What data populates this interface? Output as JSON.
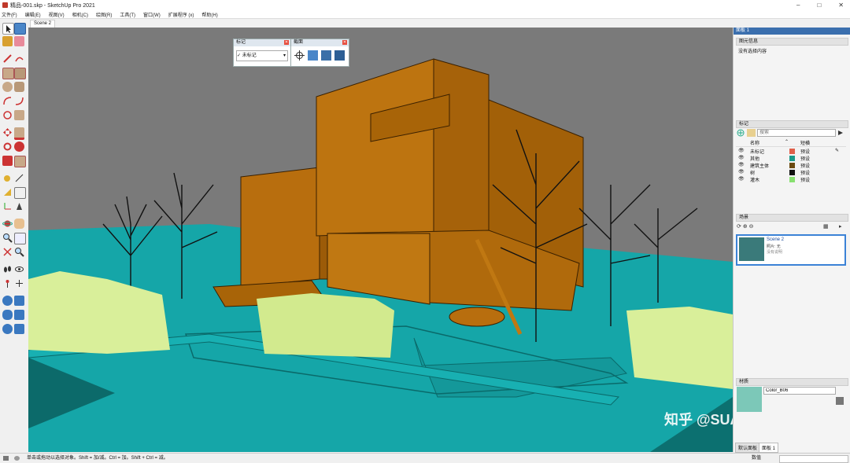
{
  "window": {
    "title": "精品-001.skp - SketchUp Pro 2021",
    "controls": [
      "–",
      "□",
      "✕"
    ]
  },
  "menu": [
    "文件(F)",
    "编辑(E)",
    "视图(V)",
    "相机(C)",
    "绘图(R)",
    "工具(T)",
    "窗口(W)",
    "扩展程序 (x)",
    "帮助(H)"
  ],
  "scene_tab": "Scene 2",
  "tag_float": {
    "title": "标记",
    "value": "未标记",
    "check": "✓"
  },
  "section_float": {
    "title": "截面"
  },
  "panel": {
    "title": "面板 1",
    "entity_info": {
      "header": "图元信息",
      "text": "没有选择内容"
    },
    "tags": {
      "header": "标记",
      "search_placeholder": "搜索",
      "col_name": "名称",
      "col_style": "短横",
      "rows": [
        {
          "name": "未标记",
          "color": "#e0604a",
          "style": "预设"
        },
        {
          "name": "其他",
          "color": "#1a9a8a",
          "style": "预设"
        },
        {
          "name": "建筑主体",
          "color": "#6a4a10",
          "style": "预设"
        },
        {
          "name": "树",
          "color": "#111111",
          "style": "预设"
        },
        {
          "name": "灌木",
          "color": "#88e070",
          "style": "预设"
        }
      ]
    },
    "scenes": {
      "header": "场景",
      "item_name": "Scene 2",
      "item_sub": "照片: 无",
      "item_sub2": "没有说明"
    },
    "materials": {
      "header": "材质",
      "name_value": "Color_B06",
      "color": "#7cc8b8"
    },
    "bottom_tabs": [
      "默认面板",
      "面板 1"
    ]
  },
  "status": {
    "hint": "单击或拖动以选择对象。Shift = 加/减。Ctrl = 加。Shift + Ctrl = 减。",
    "measure_label": "数值"
  },
  "watermark": "知乎 @SUAPP",
  "colors": {
    "sky": "#7a7a7a",
    "ground": "#15a6a8",
    "building": "#b86e0e",
    "grass": "#d9ef9a"
  }
}
